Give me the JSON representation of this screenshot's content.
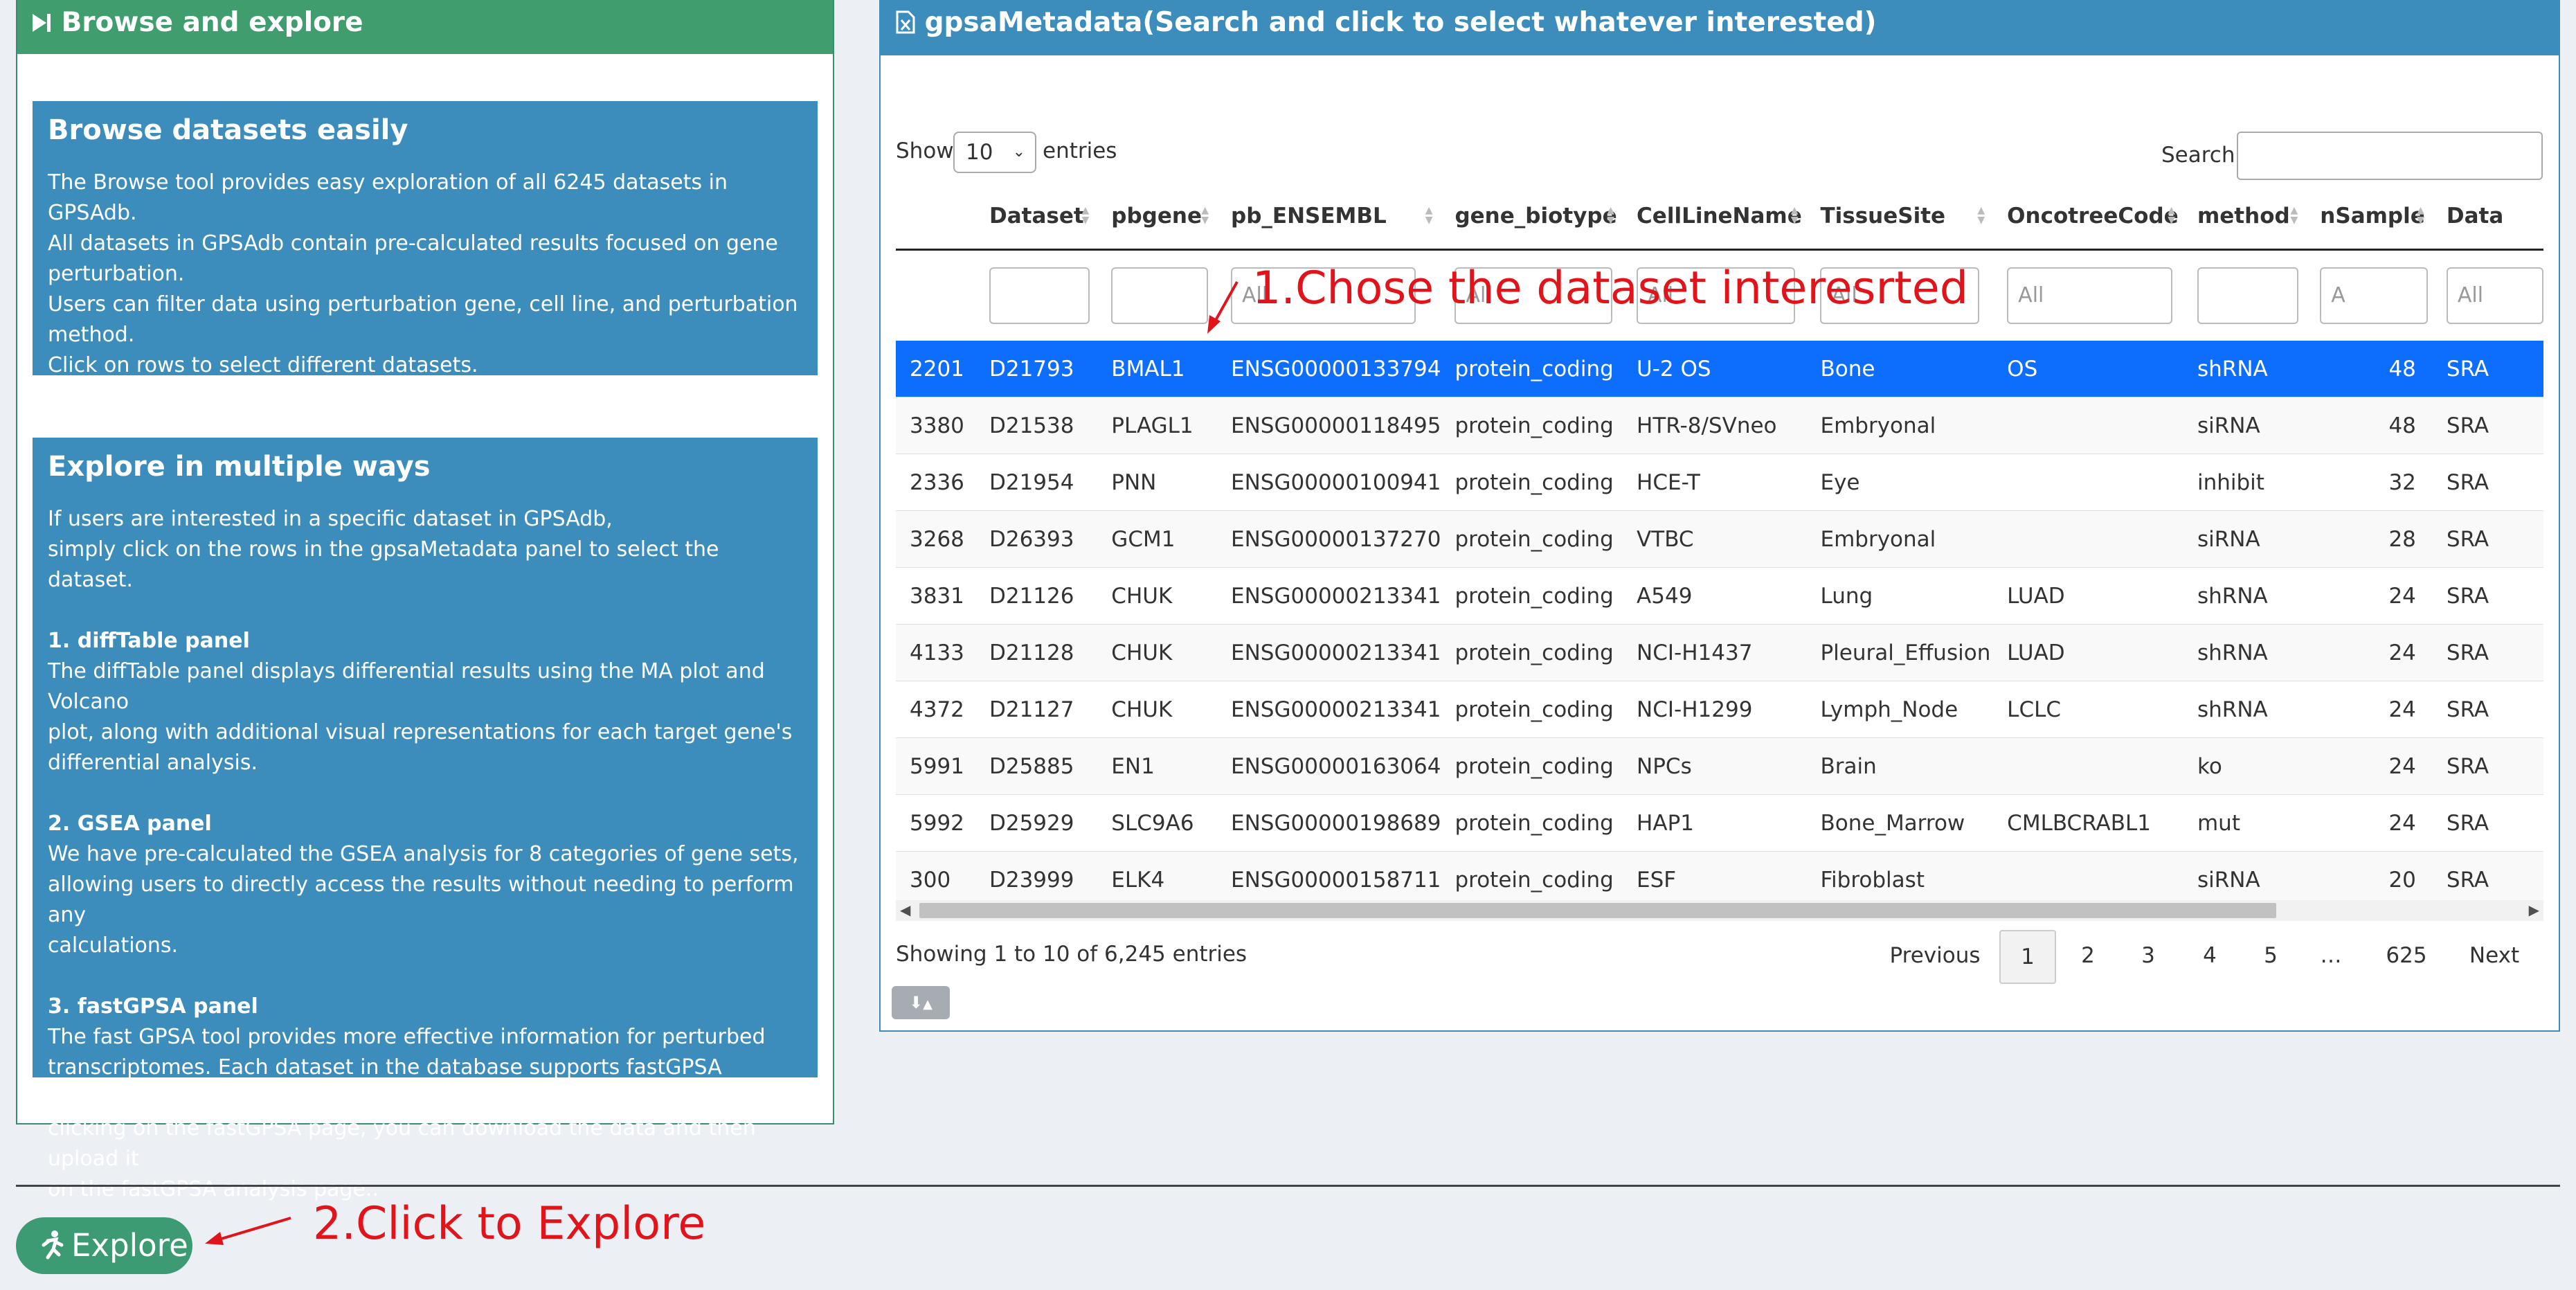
{
  "left_panel": {
    "title": "Browse and explore",
    "browse": {
      "heading": "Browse datasets easily",
      "lines": [
        "The Browse tool provides easy exploration of all 6245 datasets in GPSAdb.",
        "All datasets in GPSAdb contain pre-calculated results focused on gene",
        "perturbation.",
        "Users can filter data using perturbation gene, cell line, and perturbation",
        "method.",
        "Click on rows to select different datasets."
      ]
    },
    "explore": {
      "heading": "Explore in multiple ways",
      "intro": [
        "If users are interested in a specific dataset in GPSAdb,",
        "simply click on the rows in the gpsaMetadata panel to select the dataset."
      ],
      "sections": [
        {
          "title": "1. diffTable panel",
          "lines": [
            "The diffTable panel displays differential results using the MA plot and Volcano",
            "plot, along with additional visual representations for each target gene's",
            "differential analysis."
          ]
        },
        {
          "title": "2. GSEA panel",
          "lines": [
            "We have pre-calculated the GSEA analysis for 8 categories of gene sets,",
            "allowing users to directly access the results without needing to perform any",
            "calculations."
          ]
        },
        {
          "title": "3. fastGPSA panel",
          "lines": [
            "The fast GPSA tool provides more effective information for perturbed",
            "transcriptomes. Each dataset in the database supports fastGPSA analysis. By",
            "clicking on the fastGPSA page, you can download the data and then upload it",
            "on the fastGPSA analysis page.."
          ]
        }
      ]
    }
  },
  "right_panel": {
    "title": "gpsaMetadata(Search and click to select whatever interested)",
    "show_label": "Show",
    "entries_value": "10",
    "entries_label": "entries",
    "search_label": "Search:",
    "columns": [
      "",
      "Dataset",
      "pbgene",
      "pb_ENSEMBL",
      "gene_biotype",
      "CellLineName",
      "TissueSite",
      "OncotreeCode",
      "method",
      "nSample",
      "Data"
    ],
    "filter_placeholders": [
      "",
      "",
      "",
      "All",
      "All",
      "All",
      "All",
      "All",
      "",
      "A",
      "All"
    ],
    "rows": [
      [
        "2201",
        "D21793",
        "BMAL1",
        "ENSG00000133794",
        "protein_coding",
        "U-2 OS",
        "Bone",
        "OS",
        "shRNA",
        "48",
        "SRA"
      ],
      [
        "3380",
        "D21538",
        "PLAGL1",
        "ENSG00000118495",
        "protein_coding",
        "HTR-8/SVneo",
        "Embryonal",
        "",
        "siRNA",
        "48",
        "SRA"
      ],
      [
        "2336",
        "D21954",
        "PNN",
        "ENSG00000100941",
        "protein_coding",
        "HCE-T",
        "Eye",
        "",
        "inhibit",
        "32",
        "SRA"
      ],
      [
        "3268",
        "D26393",
        "GCM1",
        "ENSG00000137270",
        "protein_coding",
        "VTBC",
        "Embryonal",
        "",
        "siRNA",
        "28",
        "SRA"
      ],
      [
        "3831",
        "D21126",
        "CHUK",
        "ENSG00000213341",
        "protein_coding",
        "A549",
        "Lung",
        "LUAD",
        "shRNA",
        "24",
        "SRA"
      ],
      [
        "4133",
        "D21128",
        "CHUK",
        "ENSG00000213341",
        "protein_coding",
        "NCI-H1437",
        "Pleural_Effusion",
        "LUAD",
        "shRNA",
        "24",
        "SRA"
      ],
      [
        "4372",
        "D21127",
        "CHUK",
        "ENSG00000213341",
        "protein_coding",
        "NCI-H1299",
        "Lymph_Node",
        "LCLC",
        "shRNA",
        "24",
        "SRA"
      ],
      [
        "5991",
        "D25885",
        "EN1",
        "ENSG00000163064",
        "protein_coding",
        "NPCs",
        "Brain",
        "",
        "ko",
        "24",
        "SRA"
      ],
      [
        "5992",
        "D25929",
        "SLC9A6",
        "ENSG00000198689",
        "protein_coding",
        "HAP1",
        "Bone_Marrow",
        "CMLBCRABL1",
        "mut",
        "24",
        "SRA"
      ],
      [
        "300",
        "D23999",
        "ELK4",
        "ENSG00000158711",
        "protein_coding",
        "ESF",
        "Fibroblast",
        "",
        "siRNA",
        "20",
        "SRA"
      ]
    ],
    "selected_row": 0,
    "info_text": "Showing 1 to 10 of 6,245 entries",
    "pagination": {
      "previous": "Previous",
      "pages": [
        "1",
        "2",
        "3",
        "4",
        "5",
        "…",
        "625"
      ],
      "current": "1",
      "next": "Next"
    }
  },
  "explore_button": "Explore",
  "annotations": {
    "step1": "1.Chose the dataset interesrted",
    "step2": "2.Click to Explore"
  },
  "colors": {
    "left_header": "#409d6e",
    "right_header": "#3c8dbc",
    "info_box": "#3c8dbc",
    "selected_row": "#0d6efd",
    "explore_button": "#3c9b72",
    "annotation": "#e0141a"
  }
}
